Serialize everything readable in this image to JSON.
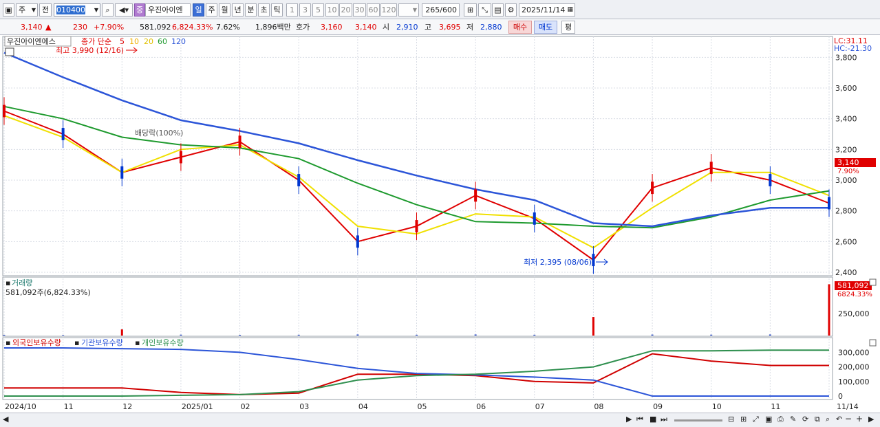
{
  "toolbar": {
    "period_type": "주",
    "prev_label": "전",
    "code": "010400",
    "stock_badge": "중",
    "stock_name": "우진아이엔",
    "periods": [
      "일",
      "주",
      "월",
      "년",
      "분",
      "초",
      "틱"
    ],
    "active_period": "일",
    "intervals": [
      "1",
      "3",
      "5",
      "10",
      "20",
      "30",
      "60",
      "120"
    ],
    "count": "265",
    "count_max": "/600",
    "date": "2025/11/14"
  },
  "quote": {
    "price": "3,140",
    "change_arrow": "▲",
    "change": "230",
    "change_pct": "+7.90%",
    "volume": "581,092",
    "volume_pct": "6,824.33%",
    "turnover": "7.62%",
    "amount": "1,896백만",
    "bid_label": "호가",
    "ask": "3,160",
    "bid": "3,140",
    "open_label": "시",
    "open": "2,910",
    "high_label": "고",
    "high": "3,695",
    "low_label": "저",
    "low": "2,880",
    "buy_label": "매수",
    "sell_label": "매도",
    "avg_label": "평"
  },
  "price_panel": {
    "stock_name": "우진아이엔에스",
    "ma_label": "종가 단순",
    "ma_periods": [
      "5",
      "10",
      "20",
      "60",
      "120"
    ],
    "high_note": "최고 3,990 (12/16)",
    "low_note": "최저 2,395 (08/06)",
    "right_badge_price": "3,140",
    "right_badge_pct": "7.90%",
    "lc_label": "LC:31.11",
    "hc_label": "HC:-21.30",
    "event_label": "배당락(100%)"
  },
  "volume_panel": {
    "title": "거래량",
    "subtitle": "581,092주(6,824.33%)",
    "badge_volume": "581,092",
    "badge_pct": "6824.33%"
  },
  "holding_panel": {
    "labels": [
      "외국인보유수량",
      "기관보유수량",
      "개인보유수량"
    ]
  },
  "x_axis": [
    "2024/10",
    "11",
    "12",
    "2025/01",
    "02",
    "03",
    "04",
    "05",
    "06",
    "07",
    "08",
    "09",
    "10",
    "11",
    "11/14"
  ],
  "colors": {
    "up": "#e00000",
    "down": "#0036d0",
    "ma5": "#e00000",
    "ma10": "#f07000",
    "ma20": "#f0e000",
    "ma60": "#1e9a2e",
    "ma120": "#2c55d8",
    "foreign": "#d00000",
    "inst": "#2c55d8",
    "retail": "#2e8f4e"
  },
  "chart_data": [
    {
      "type": "line",
      "title": "우진아이엔에스 종가 단순",
      "x": [
        "2024/10",
        "11",
        "12",
        "2025/01",
        "02",
        "03",
        "04",
        "05",
        "06",
        "07",
        "08",
        "09",
        "10",
        "11",
        "11/14"
      ],
      "series": [
        {
          "name": "5",
          "values": [
            3450,
            3300,
            3050,
            3150,
            3250,
            3000,
            2600,
            2700,
            2900,
            2750,
            2480,
            2950,
            3080,
            3000,
            2850
          ]
        },
        {
          "name": "20",
          "values": [
            3420,
            3280,
            3050,
            3200,
            3230,
            3020,
            2700,
            2650,
            2780,
            2760,
            2560,
            2820,
            3050,
            3050,
            2900
          ]
        },
        {
          "name": "60",
          "values": [
            3480,
            3400,
            3280,
            3230,
            3210,
            3140,
            2980,
            2840,
            2730,
            2720,
            2700,
            2690,
            2760,
            2870,
            2930
          ]
        },
        {
          "name": "120",
          "values": [
            3830,
            3670,
            3520,
            3390,
            3320,
            3240,
            3130,
            3030,
            2940,
            2870,
            2720,
            2700,
            2770,
            2820,
            2820
          ]
        }
      ],
      "ylim": [
        2400,
        3900
      ],
      "ticks": [
        "3,800",
        "3,600",
        "3,400",
        "3,200",
        "3,000",
        "2,800",
        "2,600",
        "2,400"
      ]
    },
    {
      "type": "bar",
      "title": "거래량",
      "x": [
        "2024/10",
        "11",
        "12",
        "2025/01",
        "02",
        "03",
        "04",
        "05",
        "06",
        "07",
        "08",
        "09",
        "10",
        "11",
        "11/14"
      ],
      "series": [
        {
          "name": "거래량",
          "values": [
            8000,
            6000,
            70000,
            10000,
            8000,
            9000,
            12000,
            9000,
            12000,
            9000,
            210000,
            11000,
            10000,
            12000,
            581092
          ]
        }
      ],
      "ticks": [
        "250,000"
      ]
    },
    {
      "type": "line",
      "x": [
        "2024/10",
        "11",
        "12",
        "2025/01",
        "02",
        "03",
        "04",
        "05",
        "06",
        "07",
        "08",
        "09",
        "10",
        "11",
        "11/14"
      ],
      "series": [
        {
          "name": "외국인보유수량",
          "values": [
            55000,
            55000,
            55000,
            25000,
            10000,
            20000,
            150000,
            150000,
            140000,
            100000,
            90000,
            290000,
            240000,
            210000,
            210000
          ]
        },
        {
          "name": "기관보유수량",
          "values": [
            330000,
            330000,
            325000,
            320000,
            300000,
            250000,
            190000,
            155000,
            145000,
            130000,
            110000,
            0,
            0,
            0,
            0
          ]
        },
        {
          "name": "개인보유수량",
          "values": [
            0,
            0,
            0,
            5000,
            10000,
            30000,
            110000,
            140000,
            150000,
            170000,
            200000,
            310000,
            310000,
            315000,
            315000
          ]
        }
      ],
      "ticks": [
        "300,000",
        "200,000",
        "100,000",
        "0"
      ]
    }
  ]
}
